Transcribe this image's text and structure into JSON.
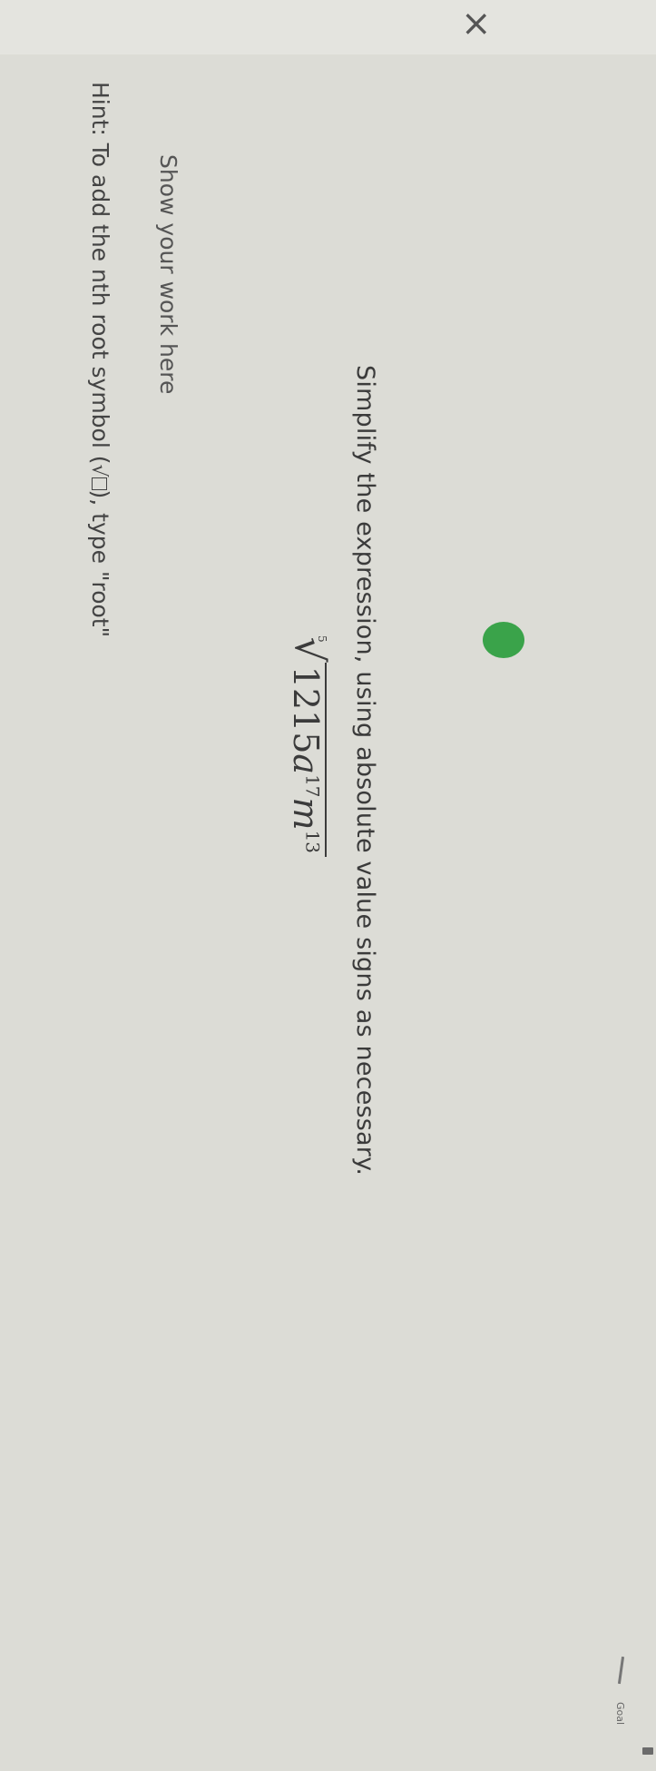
{
  "window": {
    "close_icon": "close-icon",
    "close_glyph": "×"
  },
  "progress": {
    "status": "complete",
    "color": "#3aa34a"
  },
  "goal": {
    "label": "Goal"
  },
  "question": {
    "prompt": "Simplify the expression, using absolute value signs as necessary.",
    "expression": {
      "root_index": "5",
      "root_symbol": "√",
      "coefficient": "1215",
      "var1": "a",
      "exp1": "17",
      "var2": "m",
      "exp2": "13"
    }
  },
  "work": {
    "label": "Show your work here"
  },
  "hint": {
    "prefix": "Hint: To add the nth root symbol (",
    "symbol": "√",
    "suffix": "), type \"root\""
  }
}
